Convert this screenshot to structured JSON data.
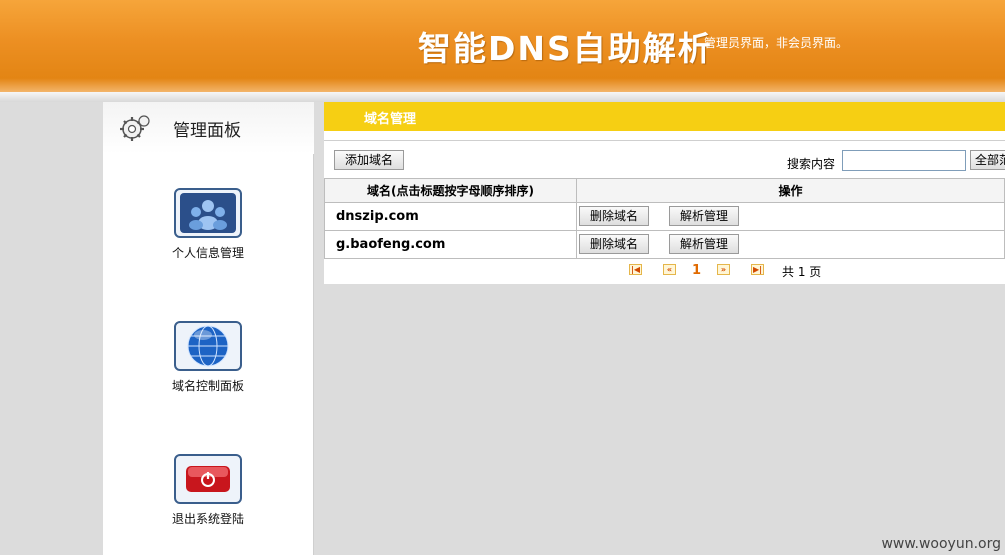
{
  "header": {
    "title": "智能DNS自助解析",
    "subtitle": "管理员界面，非会员界面。"
  },
  "sidebar": {
    "title": "管理面板",
    "items": [
      {
        "label": "个人信息管理",
        "icon": "users-icon"
      },
      {
        "label": "域名控制面板",
        "icon": "globe-icon"
      },
      {
        "label": "退出系统登陆",
        "icon": "power-icon"
      }
    ]
  },
  "main": {
    "title": "域名管理",
    "add_button": "添加域名",
    "search_label": "搜索内容",
    "search_value": "",
    "search_button": "全部范",
    "table": {
      "headers": [
        "域名(点击标题按字母顺序排序)",
        "操作"
      ],
      "rows": [
        {
          "domain": "dnszip.com",
          "delete": "删除域名",
          "manage": "解析管理"
        },
        {
          "domain": "g.baofeng.com",
          "delete": "删除域名",
          "manage": "解析管理"
        }
      ]
    },
    "pager": {
      "current": "1",
      "total": "共 1 页"
    }
  },
  "watermark": "www.wooyun.org",
  "colors": {
    "header_orange": "#ec8f22",
    "title_bar_yellow": "#f6cf13",
    "background": "#dcdcdc"
  }
}
